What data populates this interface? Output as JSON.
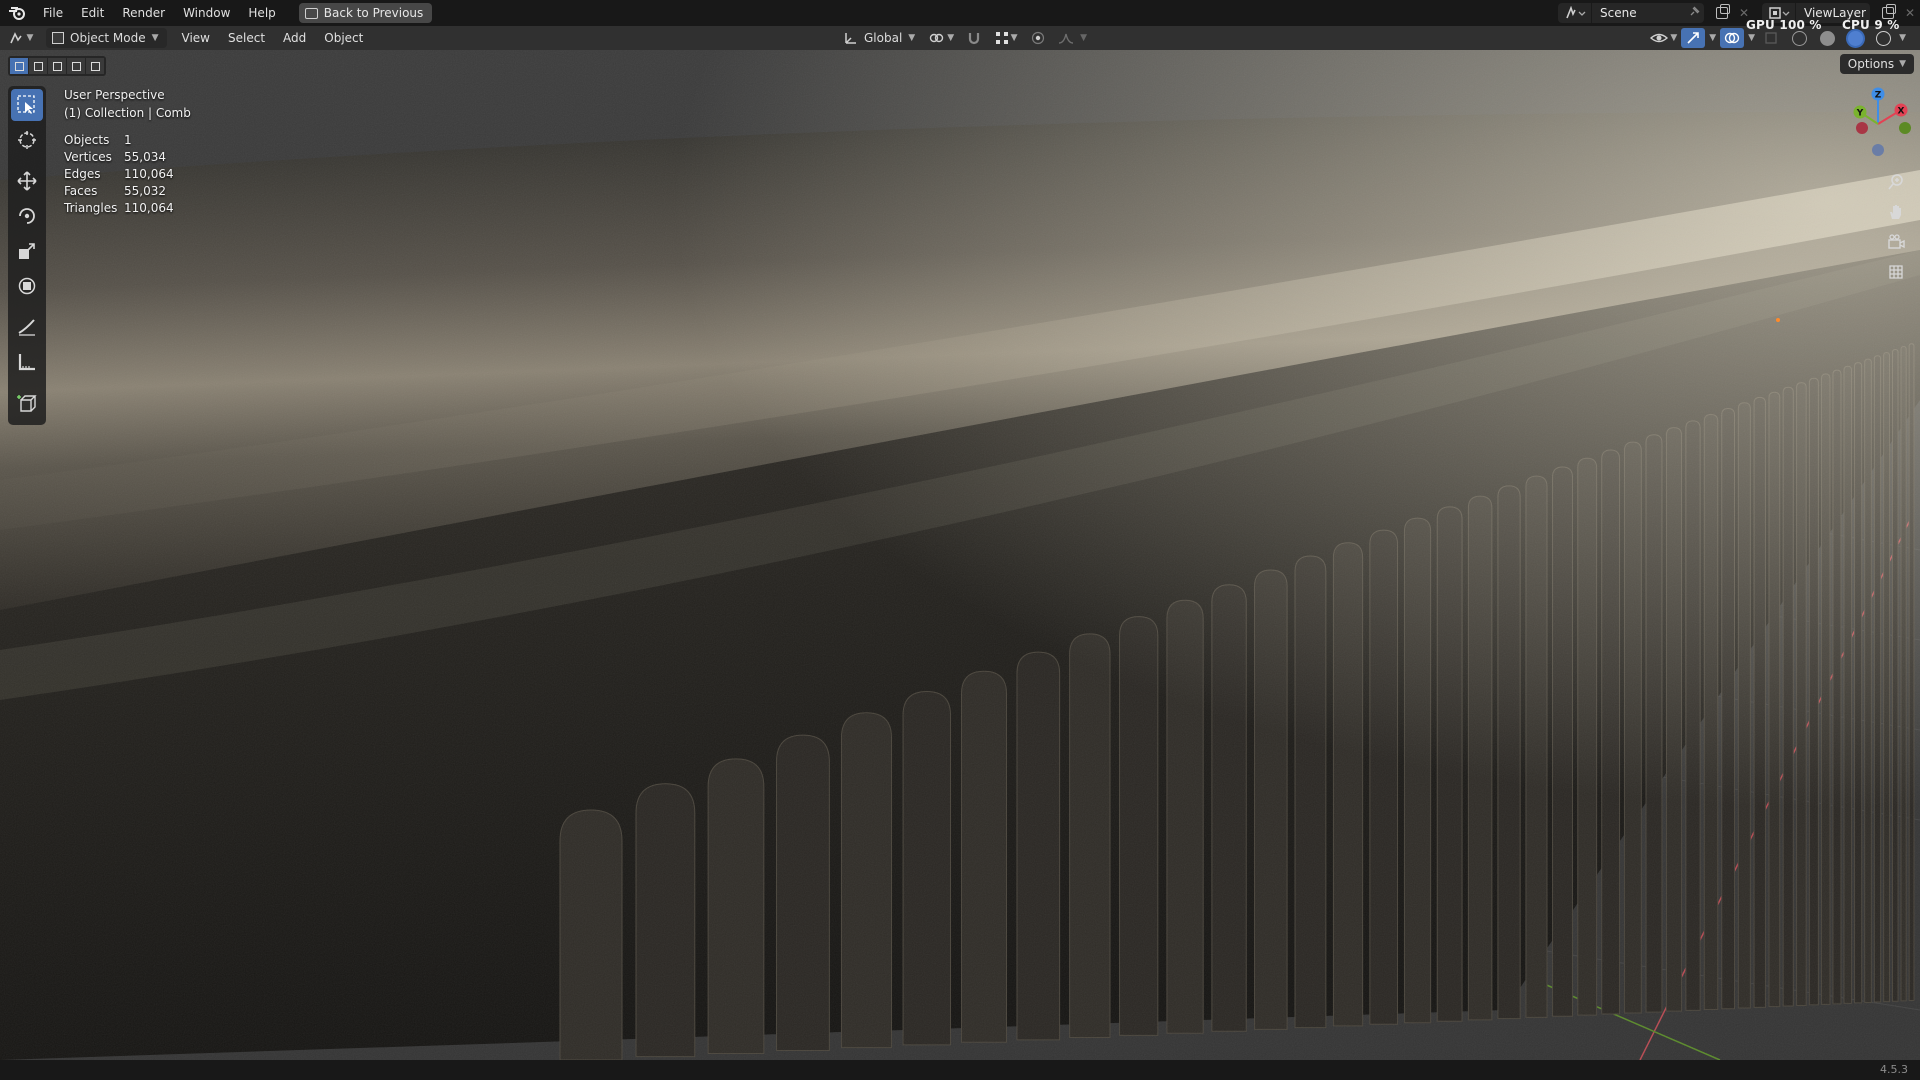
{
  "topbar": {
    "menus": [
      "File",
      "Edit",
      "Render",
      "Window",
      "Help"
    ],
    "back_button": "Back to Previous",
    "scene_name": "Scene",
    "view_layer": "ViewLayer"
  },
  "header": {
    "mode": "Object Mode",
    "menus": [
      "View",
      "Select",
      "Add",
      "Object"
    ],
    "orientation": "Global",
    "options": "Options"
  },
  "performance": {
    "gpu_label": "GPU",
    "gpu_value": "100 %",
    "cpu_label": "CPU",
    "cpu_value": "9 %"
  },
  "viewport": {
    "perspective": "User Perspective",
    "collection": "(1) Collection | Comb",
    "stats": [
      {
        "label": "Objects",
        "value": "1"
      },
      {
        "label": "Vertices",
        "value": "55,034"
      },
      {
        "label": "Edges",
        "value": "110,064"
      },
      {
        "label": "Faces",
        "value": "55,032"
      },
      {
        "label": "Triangles",
        "value": "110,064"
      }
    ],
    "gizmo_axes": {
      "x": "X",
      "y": "Y",
      "z": "Z"
    }
  },
  "tools": [
    "select-box-tool",
    "cursor-tool",
    "move-tool",
    "rotate-tool",
    "scale-tool",
    "transform-tool",
    "annotate-tool",
    "measure-tool",
    "add-cube-tool"
  ],
  "nav_tools": [
    "zoom-icon",
    "pan-hand-icon",
    "camera-icon",
    "grid-icon"
  ],
  "statusbar": {
    "version": "4.5.3"
  },
  "colors": {
    "accent": "#4772b3",
    "axis_x": "#e34254",
    "axis_y": "#7ab32e",
    "axis_z": "#3f8ee8",
    "object_surface": "#3d382f"
  }
}
